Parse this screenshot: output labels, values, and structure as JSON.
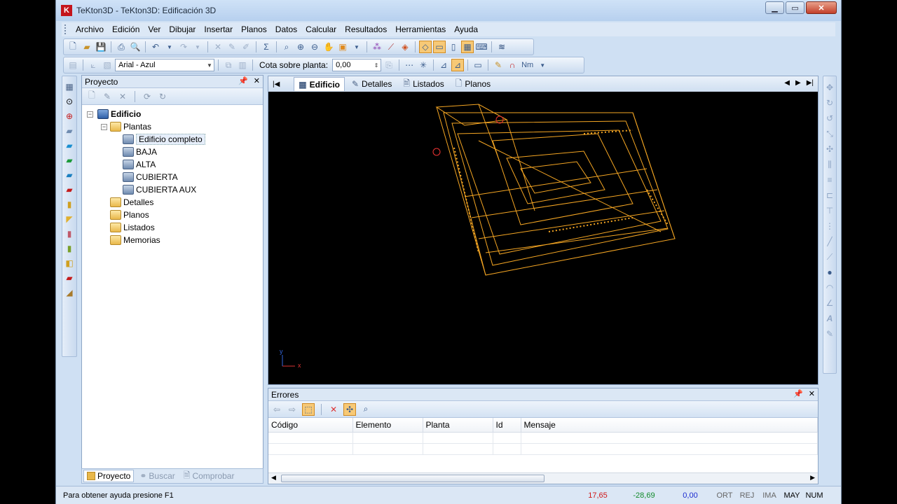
{
  "window": {
    "title": "TeKton3D - TeKton3D: Edificación 3D",
    "app_icon": "K"
  },
  "menu": [
    "Archivo",
    "Edición",
    "Ver",
    "Dibujar",
    "Insertar",
    "Planos",
    "Datos",
    "Calcular",
    "Resultados",
    "Herramientas",
    "Ayuda"
  ],
  "toolbar2": {
    "font_combo": "Arial - Azul",
    "cota_label": "Cota sobre planta:",
    "cota_value": "0,00",
    "nm_label": "Nm"
  },
  "project_panel": {
    "title": "Proyecto",
    "tree": {
      "root": "Edificio",
      "plantas": "Plantas",
      "plant_items": [
        "Edificio completo",
        "BAJA",
        "ALTA",
        "CUBIERTA",
        "CUBIERTA AUX"
      ],
      "other_folders": [
        "Detalles",
        "Planos",
        "Listados",
        "Memorias"
      ]
    },
    "bottom_tabs": [
      "Proyecto",
      "Buscar",
      "Comprobar"
    ]
  },
  "viewport": {
    "tabs": [
      "Edificio",
      "Detalles",
      "Listados",
      "Planos"
    ],
    "axis_x": "x",
    "axis_y": "y",
    "drawing_color": "#f5a623"
  },
  "errors_panel": {
    "title": "Errores",
    "columns": [
      "Código",
      "Elemento",
      "Planta",
      "Id",
      "Mensaje"
    ]
  },
  "status_bar": {
    "help": "Para obtener ayuda presione F1",
    "x": "17,65",
    "y": "-28,69",
    "z": "0,00",
    "flags": [
      "ORT",
      "REJ",
      "IMA",
      "MAY",
      "NUM"
    ]
  }
}
